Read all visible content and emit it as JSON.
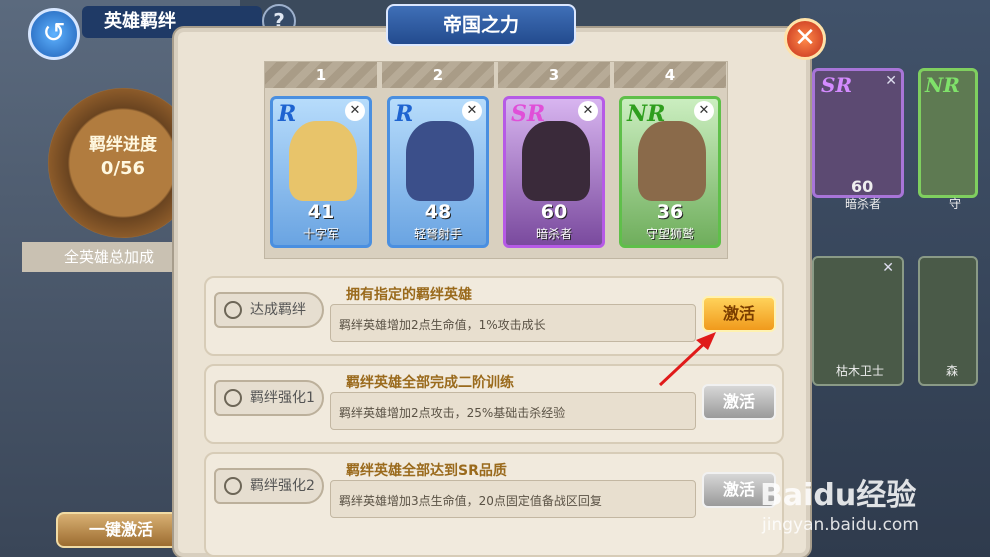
{
  "left_panel": {
    "back_icon": "back-arrow-icon",
    "title": "英雄羁绊",
    "help": "?",
    "progress_label": "羁绊进度",
    "progress_value": "0/56",
    "all_bonus": "全英雄总加成",
    "one_key_activate": "一键激活"
  },
  "right_bg": {
    "cards": [
      {
        "rarity": "SR",
        "level": "60",
        "name": "暗杀者"
      },
      {
        "rarity": "NR",
        "level": "",
        "name": "守"
      }
    ],
    "guard_name": "枯木卫士",
    "guard_name_2": "森"
  },
  "dialog": {
    "title": "帝国之力",
    "close": "✕",
    "slots": [
      {
        "num": "1",
        "rarity": "R",
        "level": "41",
        "name": "十字军",
        "border": "#4a8fe0",
        "bg": "#8fc3f4",
        "hero": "#e8c46a"
      },
      {
        "num": "2",
        "rarity": "R",
        "level": "48",
        "name": "轻弩射手",
        "border": "#4a8fe0",
        "bg": "#8fc3f4",
        "hero": "#3b4f8a"
      },
      {
        "num": "3",
        "rarity": "SR",
        "level": "60",
        "name": "暗杀者",
        "border": "#b65ae6",
        "bg": "#c99be8",
        "hero": "#3a2a3a"
      },
      {
        "num": "4",
        "rarity": "NR",
        "level": "36",
        "name": "守望狮鹫",
        "border": "#5fbf4a",
        "bg": "#a6dd8c",
        "hero": "#8a6a4a"
      }
    ],
    "rows": [
      {
        "tag": "达成羁绊",
        "condition": "拥有指定的羁绊英雄",
        "desc": "羁绊英雄增加2点生命值，1%攻击成长",
        "button": "激活",
        "active": true
      },
      {
        "tag": "羁绊强化1",
        "condition": "羁绊英雄全部完成二阶训练",
        "desc": "羁绊英雄增加2点攻击，25%基础击杀经验",
        "button": "激活",
        "active": false
      },
      {
        "tag": "羁绊强化2",
        "condition": "羁绊英雄全部达到SR品质",
        "desc": "羁绊英雄增加3点生命值，20点固定值备战区回复",
        "button": "激活",
        "active": false
      }
    ]
  },
  "watermark": {
    "text": "Baidu经验",
    "url": "jingyan.baidu.com"
  }
}
